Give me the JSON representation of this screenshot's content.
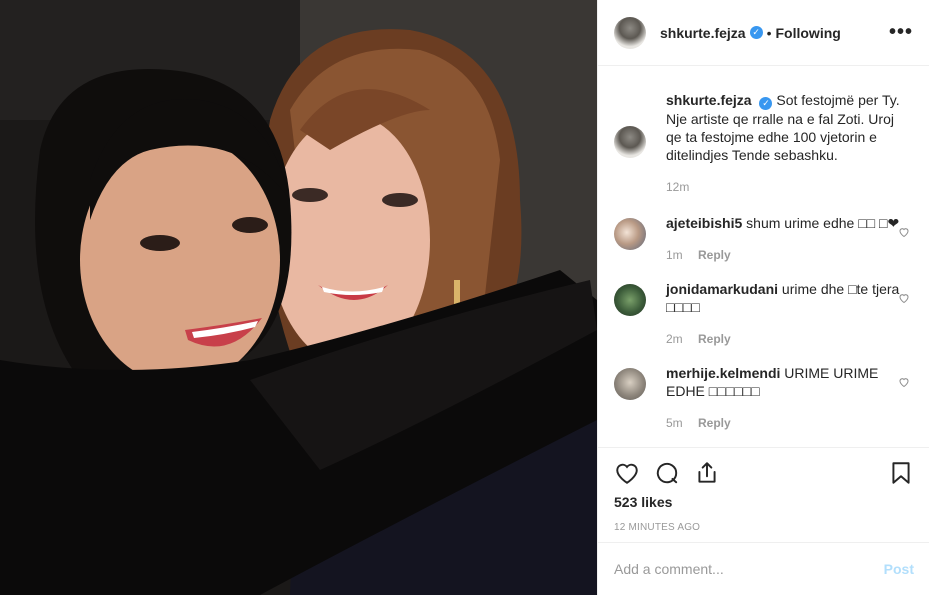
{
  "post": {
    "image_alt": "Two women embracing"
  },
  "header": {
    "username": "shkurte.fejza",
    "separator": "•",
    "follow_label": "Following",
    "more_label": "•••"
  },
  "caption": {
    "username": "shkurte.fejza",
    "text": "Sot festojmë per Ty. Nje artiste qe rralle na e fal Zoti. Uroj qe ta festojme edhe 100 vjetorin e ditelindjes Tende sebashku.",
    "time": "12m"
  },
  "comments": [
    {
      "username": "ajeteibishi5",
      "text": "shum urime edhe □□ □❤",
      "time": "1m",
      "reply": "Reply"
    },
    {
      "username": "jonidamarkudani",
      "text": "urime dhe □te tjera □□□□",
      "time": "2m",
      "reply": "Reply"
    },
    {
      "username": "merhije.kelmendi",
      "text": "URIME URIME EDHE □□□□□□",
      "time": "5m",
      "reply": "Reply"
    }
  ],
  "stats": {
    "likes": "523 likes",
    "timestamp": "12 MINUTES AGO"
  },
  "composer": {
    "placeholder": "Add a comment...",
    "post_label": "Post"
  },
  "colors": {
    "verified": "#3897f0",
    "post_disabled": "#b2dffc",
    "muted": "#999999"
  }
}
